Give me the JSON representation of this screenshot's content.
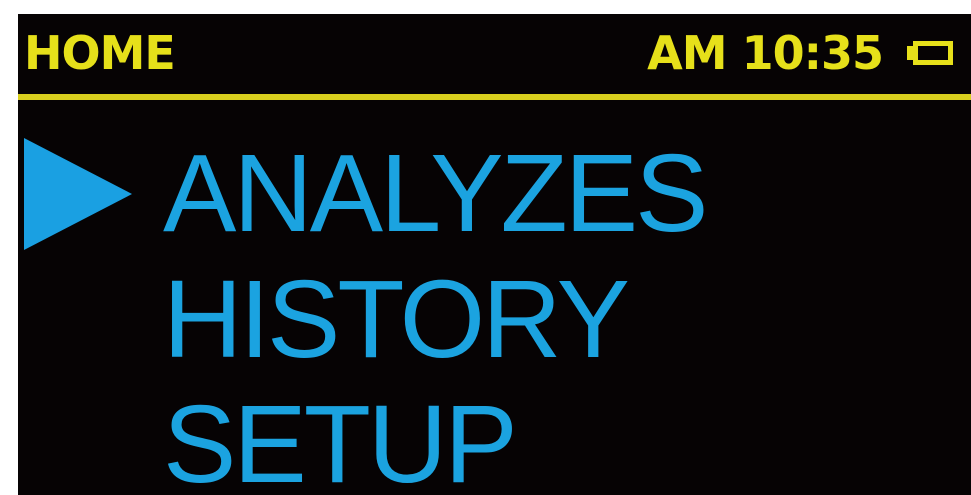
{
  "status_bar": {
    "title": "HOME",
    "time": "AM 10:35",
    "battery_icon": "battery-icon"
  },
  "menu": {
    "selected_index": 0,
    "items": [
      {
        "label": "ANALYZES"
      },
      {
        "label": "HISTORY"
      },
      {
        "label": "SETUP"
      }
    ]
  },
  "colors": {
    "background": "#060304",
    "status_text": "#e6e01a",
    "divider": "#d9cf1e",
    "menu_text": "#1ba3e0",
    "selector": "#1aa0e2"
  }
}
